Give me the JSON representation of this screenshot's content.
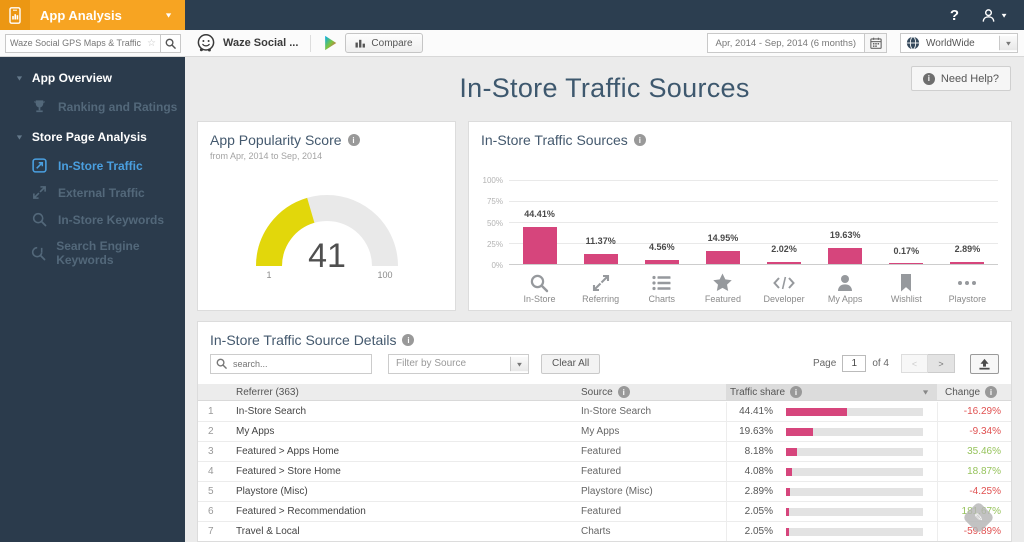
{
  "header": {
    "brand": "App Analysis",
    "help": "?",
    "search_value": "Waze Social GPS Maps & Traffic",
    "app_name": "Waze Social ...",
    "compare": "Compare",
    "date_range": "Apr, 2014 - Sep, 2014 (6 months)",
    "region": "WorldWide"
  },
  "sidebar": {
    "sections": [
      {
        "label": "App Overview",
        "items": [
          {
            "label": "Ranking and Ratings"
          }
        ]
      },
      {
        "label": "Store Page Analysis",
        "items": [
          {
            "label": "In-Store Traffic"
          },
          {
            "label": "External Traffic"
          },
          {
            "label": "In-Store Keywords"
          },
          {
            "label": "Search Engine Keywords"
          }
        ]
      }
    ]
  },
  "page": {
    "title": "In-Store Traffic Sources",
    "need_help": "Need Help?"
  },
  "popularity": {
    "title": "App Popularity Score",
    "subtitle": "from Apr, 2014 to Sep, 2014",
    "score": 41,
    "min": "1",
    "max": "100",
    "gauge_color": "#E2D70B",
    "gauge_track_color": "#E9E9E9"
  },
  "chart_data": {
    "type": "bar",
    "title": "In-Store Traffic Sources",
    "categories": [
      "In-Store",
      "Referring",
      "Charts",
      "Featured",
      "Developer",
      "My Apps",
      "Wishlist",
      "Playstore"
    ],
    "values": [
      44.41,
      11.37,
      4.56,
      14.95,
      2.02,
      19.63,
      0.17,
      2.89
    ],
    "unit": "%",
    "yticks": [
      "100%",
      "75%",
      "50%",
      "25%",
      "0%"
    ],
    "ylim": [
      0,
      100
    ],
    "grid": true,
    "bar_color": "#D6457C"
  },
  "details": {
    "title": "In-Store Traffic Source Details",
    "search_placeholder": "search...",
    "filter_placeholder": "Filter by Source",
    "clear_all": "Clear All",
    "pagination": {
      "page_label": "Page",
      "page_value": "1",
      "of_label": "of 4",
      "prev": "<",
      "next": ">"
    },
    "columns": {
      "referrer": "Referrer (363)",
      "source": "Source",
      "traffic_share": "Traffic share",
      "change": "Change"
    },
    "rows": [
      {
        "rank": "1",
        "referrer": "In-Store Search",
        "source": "In-Store Search",
        "share": "44.41%",
        "share_value": 44.41,
        "change": "-16.29%"
      },
      {
        "rank": "2",
        "referrer": "My Apps",
        "source": "My Apps",
        "share": "19.63%",
        "share_value": 19.63,
        "change": "-9.34%"
      },
      {
        "rank": "3",
        "referrer": "Featured > Apps Home",
        "source": "Featured",
        "share": "8.18%",
        "share_value": 8.18,
        "change": "35.46%"
      },
      {
        "rank": "4",
        "referrer": "Featured > Store Home",
        "source": "Featured",
        "share": "4.08%",
        "share_value": 4.08,
        "change": "18.87%"
      },
      {
        "rank": "5",
        "referrer": "Playstore (Misc)",
        "source": "Playstore (Misc)",
        "share": "2.89%",
        "share_value": 2.89,
        "change": "-4.25%"
      },
      {
        "rank": "6",
        "referrer": "Featured > Recommendation",
        "source": "Featured",
        "share": "2.05%",
        "share_value": 2.05,
        "change": "181.67%"
      },
      {
        "rank": "7",
        "referrer": "Travel & Local",
        "source": "Charts",
        "share": "2.05%",
        "share_value": 2.05,
        "change": "-59.89%"
      }
    ],
    "colors": {
      "positive": "#96C35C",
      "negative": "#E05151",
      "bar": "#D6457C",
      "track": "#E3E3E3"
    }
  },
  "icons": [
    "phone-analytics-icon",
    "search-icon",
    "star-icon",
    "waze-icon",
    "google-play-icon",
    "bar-chart-icon",
    "calendar-icon",
    "globe-icon",
    "question-icon",
    "user-icon",
    "trophy-icon",
    "traffic-icon",
    "arrows-icon",
    "keywords-icon",
    "info-icon",
    "list-icon",
    "featured-star-icon",
    "code-icon",
    "person-icon",
    "bookmark-icon",
    "ellipsis-icon",
    "export-icon",
    "pencil-icon"
  ]
}
